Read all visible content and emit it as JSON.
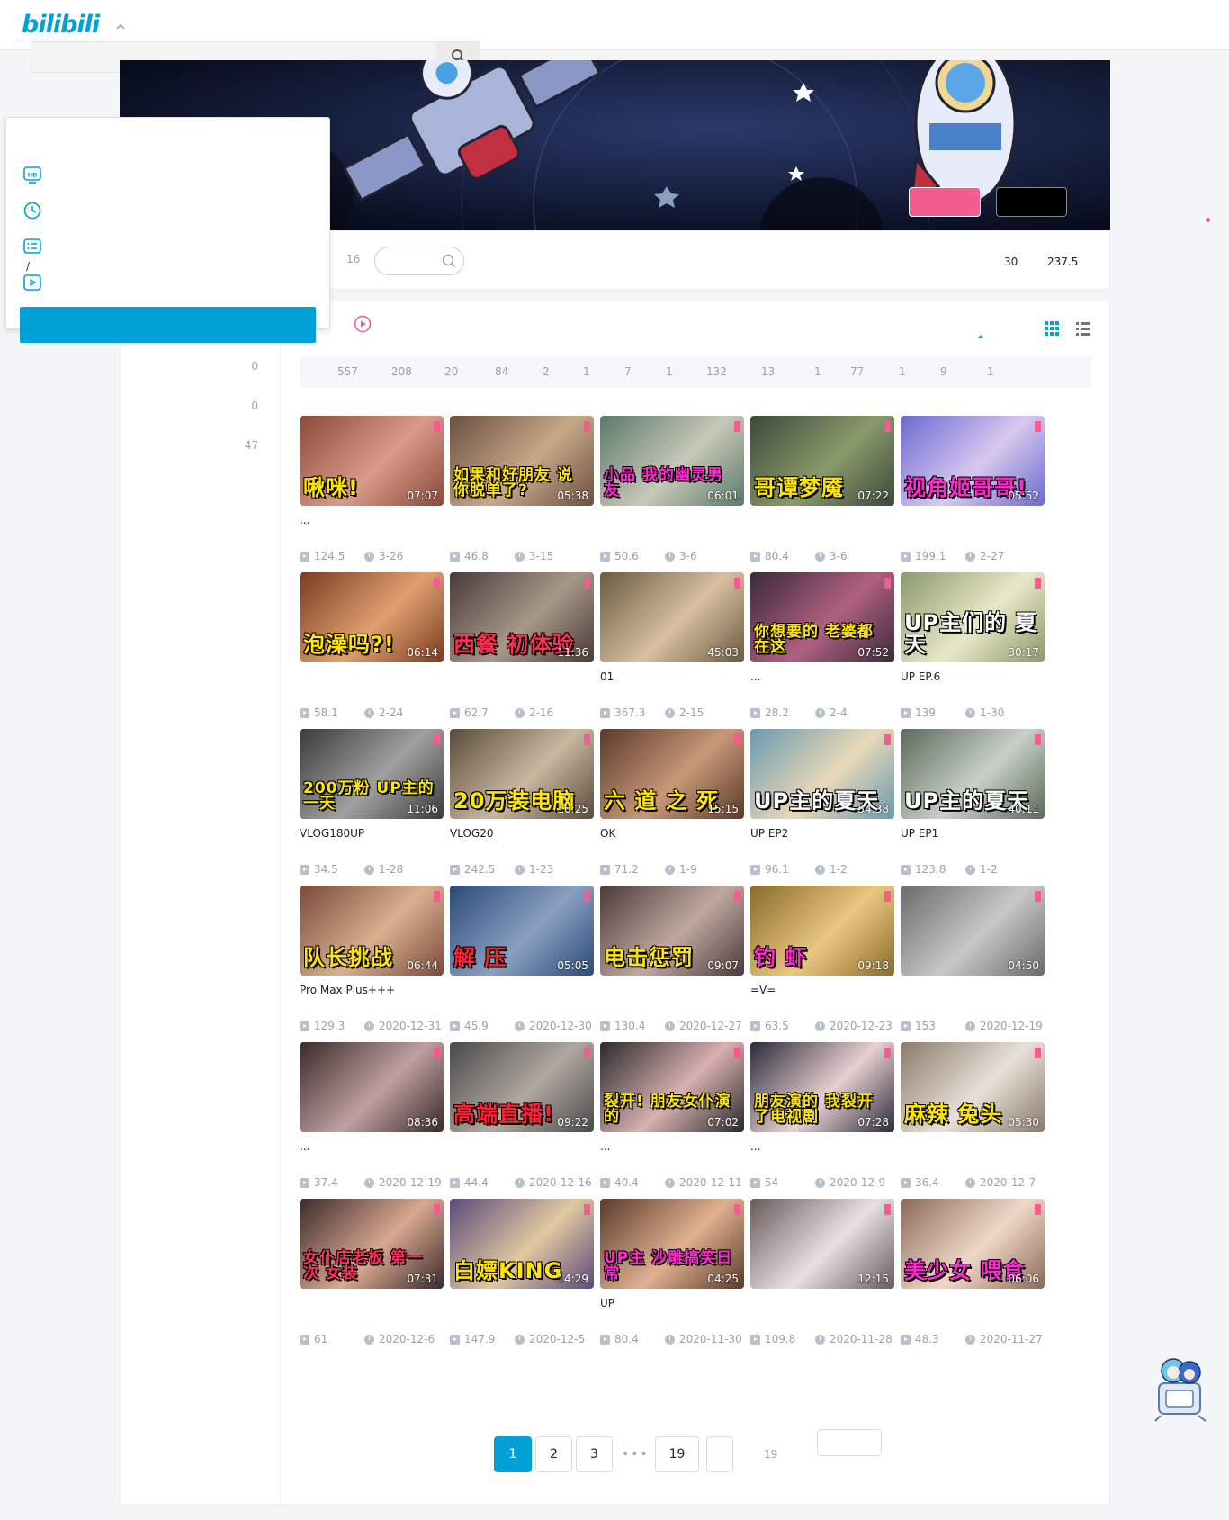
{
  "header": {
    "logo": "bilibili",
    "search_placeholder": ""
  },
  "nav": {
    "video_count": "16",
    "stats": [
      "30",
      "237.5"
    ]
  },
  "left_column": {
    "counts": [
      "0",
      "0",
      "47"
    ]
  },
  "popup": {
    "slash": "/"
  },
  "tags": [
    "557",
    "208",
    "20",
    "84",
    "2",
    "1",
    "7",
    "1",
    "132",
    "13",
    "1",
    "77",
    "1",
    "9",
    "1"
  ],
  "videos": [
    {
      "title": "...",
      "caption": "啾咪!",
      "duration": "07:07",
      "plays": "124.5",
      "date": "3-26",
      "bg": "#8a4a3a",
      "bg2": "#d99a88",
      "cap_color": "#ffe600"
    },
    {
      "title": "",
      "caption": "如果和好朋友 说 你脱单了?",
      "duration": "05:38",
      "plays": "46.8",
      "date": "3-15",
      "bg": "#6a5040",
      "bg2": "#c8a888",
      "cap_color": "#ffe600"
    },
    {
      "title": "",
      "caption": "小品 我的幽灵男友",
      "duration": "06:01",
      "plays": "50.6",
      "date": "3-6",
      "bg": "#5a7a6a",
      "bg2": "#c8c8b8",
      "cap_color": "#ff2ad0"
    },
    {
      "title": "",
      "caption": "哥谭梦魇",
      "duration": "07:22",
      "plays": "80.4",
      "date": "3-6",
      "bg": "#3a4a3a",
      "bg2": "#8a9a6a",
      "cap_color": "#ffe600"
    },
    {
      "title": "",
      "caption": "视角姬哥哥!",
      "duration": "05:52",
      "plays": "199.1",
      "date": "2-27",
      "bg": "#6a6ad0",
      "bg2": "#d8c8f0",
      "cap_color": "#ff2ad0"
    },
    {
      "title": "",
      "caption": "泡澡吗?!",
      "duration": "06:14",
      "plays": "58.1",
      "date": "2-24",
      "bg": "#7a3a20",
      "bg2": "#e0a070",
      "cap_color": "#ffe600"
    },
    {
      "title": "",
      "caption": "西餐 初体验",
      "duration": "11:36",
      "plays": "62.7",
      "date": "2-16",
      "bg": "#4a3a3a",
      "bg2": "#a89888",
      "cap_color": "#ff3050"
    },
    {
      "title": "01",
      "caption": "",
      "duration": "45:03",
      "plays": "367.3",
      "date": "2-15",
      "bg": "#6a5a40",
      "bg2": "#d8c0a0",
      "cap_color": "#ff8a30"
    },
    {
      "title": "...",
      "caption": "你想要的 老婆都在这",
      "duration": "07:52",
      "plays": "28.2",
      "date": "2-4",
      "bg": "#3a2a3a",
      "bg2": "#b06080",
      "cap_color": "#ffe600"
    },
    {
      "title": "UP EP.6",
      "caption": "UP主们的 夏天",
      "duration": "30:17",
      "plays": "139",
      "date": "1-30",
      "bg": "#8a9a6a",
      "bg2": "#e8e8c8",
      "cap_color": "#ffffff"
    },
    {
      "title": "VLOG180UP",
      "caption": "200万粉 UP主的一天",
      "duration": "11:06",
      "plays": "34.5",
      "date": "1-28",
      "bg": "#3a3a3a",
      "bg2": "#a0a0a0",
      "cap_color": "#ffe600"
    },
    {
      "title": "VLOG20",
      "caption": "20万装电脑",
      "duration": "10:25",
      "plays": "242.5",
      "date": "1-23",
      "bg": "#5a4a3a",
      "bg2": "#c8b8a0",
      "cap_color": "#ffe600"
    },
    {
      "title": "OK",
      "caption": "六 道 之 死",
      "duration": "15:15",
      "plays": "71.2",
      "date": "1-9",
      "bg": "#5a3a2a",
      "bg2": "#c89878",
      "cap_color": "#ffe600"
    },
    {
      "title": "UP EP2",
      "caption": "UP主的夏天",
      "duration": "54:38",
      "plays": "96.1",
      "date": "1-2",
      "bg": "#6a9ab0",
      "bg2": "#e8d8b8",
      "cap_color": "#ffffff"
    },
    {
      "title": "UP EP1",
      "caption": "UP主的夏天",
      "duration": "40:11",
      "plays": "123.8",
      "date": "1-2",
      "bg": "#5a6a5a",
      "bg2": "#c8d0c8",
      "cap_color": "#ffffff"
    },
    {
      "title": "Pro Max Plus+++",
      "caption": "队长挑战",
      "duration": "06:44",
      "plays": "129.3",
      "date": "2020-12-31",
      "bg": "#7a4a3a",
      "bg2": "#d8b090",
      "cap_color": "#ffe600"
    },
    {
      "title": "",
      "caption": "解 压",
      "duration": "05:05",
      "plays": "45.9",
      "date": "2020-12-30",
      "bg": "#2a4a7a",
      "bg2": "#8aa0c0",
      "cap_color": "#ff2030"
    },
    {
      "title": "",
      "caption": "电击惩罚",
      "duration": "09:07",
      "plays": "130.4",
      "date": "2020-12-27",
      "bg": "#4a3a3a",
      "bg2": "#c0a8a0",
      "cap_color": "#ffe600"
    },
    {
      "title": "=V=",
      "caption": "钓 虾",
      "duration": "09:18",
      "plays": "63.5",
      "date": "2020-12-23",
      "bg": "#8a6a2a",
      "bg2": "#e8c880",
      "cap_color": "#ff2ad0"
    },
    {
      "title": "",
      "caption": "",
      "duration": "04:50",
      "plays": "153",
      "date": "2020-12-19",
      "bg": "#6a6a6a",
      "bg2": "#c8c8c8",
      "cap_color": "#ffffff"
    },
    {
      "title": "...",
      "caption": "",
      "duration": "08:36",
      "plays": "37.4",
      "date": "2020-12-19",
      "bg": "#3a2a2a",
      "bg2": "#c0a0a0",
      "cap_color": "#ffffff"
    },
    {
      "title": "",
      "caption": "高端直播!",
      "duration": "09:22",
      "plays": "44.4",
      "date": "2020-12-16",
      "bg": "#4a4a4a",
      "bg2": "#b0a8a0",
      "cap_color": "#ff2030"
    },
    {
      "title": "...",
      "caption": "裂开! 朋友女仆演的",
      "duration": "07:02",
      "plays": "40.4",
      "date": "2020-12-11",
      "bg": "#2a2a2a",
      "bg2": "#d8b0b0",
      "cap_color": "#ffe600"
    },
    {
      "title": "...",
      "caption": "朋友演的 我裂开了电视剧",
      "duration": "07:28",
      "plays": "54",
      "date": "2020-12-9",
      "bg": "#2a2a3a",
      "bg2": "#e8d0d0",
      "cap_color": "#ffe600"
    },
    {
      "title": "",
      "caption": "麻辣 兔头",
      "duration": "05:30",
      "plays": "36.4",
      "date": "2020-12-7",
      "bg": "#8a7a6a",
      "bg2": "#e8e0d8",
      "cap_color": "#ffe600"
    },
    {
      "title": "",
      "caption": "女仆店老板 第一次 女装",
      "duration": "07:31",
      "plays": "61",
      "date": "2020-12-6",
      "bg": "#3a2a2a",
      "bg2": "#d8a890",
      "cap_color": "#ff3060"
    },
    {
      "title": "",
      "caption": "白嫖KING",
      "duration": "14:29",
      "plays": "147.9",
      "date": "2020-12-5",
      "bg": "#5a4a7a",
      "bg2": "#e0c8a0",
      "cap_color": "#ffe600"
    },
    {
      "title": "UP",
      "caption": "UP主 沙雕搞笑日常",
      "duration": "04:25",
      "plays": "80.4",
      "date": "2020-11-30",
      "bg": "#5a3a2a",
      "bg2": "#e0b090",
      "cap_color": "#ff2ad0"
    },
    {
      "title": "",
      "caption": "",
      "duration": "12:15",
      "plays": "109.8",
      "date": "2020-11-28",
      "bg": "#6a5a5a",
      "bg2": "#e8e0e0",
      "cap_color": "#ffffff"
    },
    {
      "title": "",
      "caption": "美少女 喂食",
      "duration": "06:06",
      "plays": "48.3",
      "date": "2020-11-27",
      "bg": "#8a6a5a",
      "bg2": "#f0d8c8",
      "cap_color": "#ff2ad0"
    }
  ],
  "pagination": {
    "pages": [
      "1",
      "2",
      "3",
      "19",
      ""
    ],
    "dots": "•••",
    "total": "19"
  },
  "colors": {
    "accent": "#00a1d6",
    "pink": "#f25d8e"
  }
}
